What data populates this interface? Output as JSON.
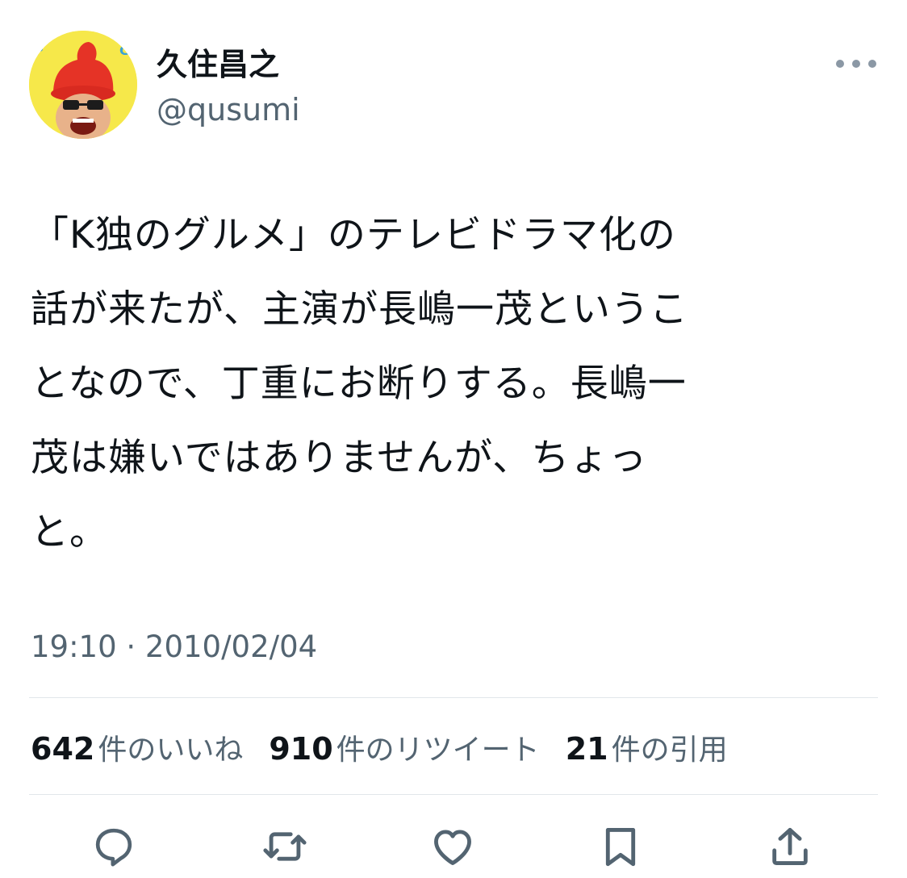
{
  "author": {
    "display_name": "久住昌之",
    "handle": "@qusumi"
  },
  "tweet": {
    "lines": [
      "「K独のグルメ」のテレビドラマ化の",
      "話が来たが、主演が長嶋一茂というこ",
      "となので、丁重にお断りする。長嶋一",
      "茂は嫌いではありませんが、ちょっ",
      "と。"
    ],
    "timestamp": "19:10 · 2010/02/04"
  },
  "stats": {
    "likes_count": "642",
    "likes_label": "件のいいね",
    "retweets_count": "910",
    "retweets_label": "件のリツイート",
    "quotes_count": "21",
    "quotes_label": "件の引用"
  },
  "icons": {
    "more": "more-icon",
    "reply": "reply-icon",
    "retweet": "retweet-icon",
    "like": "like-icon",
    "bookmark": "bookmark-icon",
    "share": "share-icon"
  },
  "colors": {
    "text": "#0f1419",
    "secondary": "#536471",
    "divider": "#e1e6ea",
    "icon": "#536471"
  }
}
